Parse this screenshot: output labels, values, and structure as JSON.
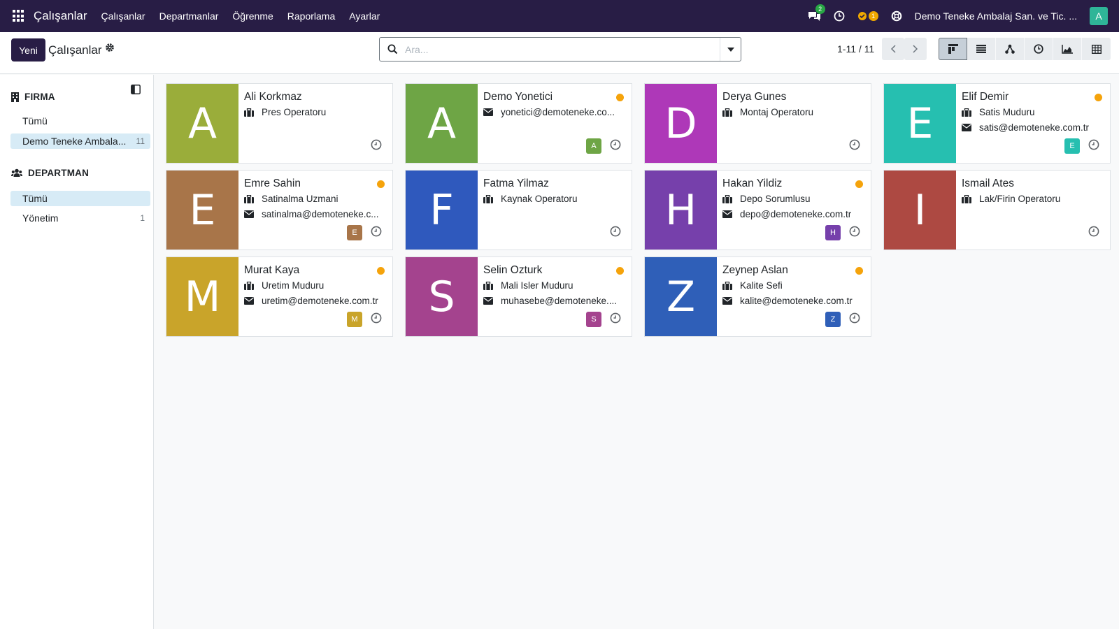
{
  "navbar": {
    "app_name": "Çalışanlar",
    "menu": [
      "Çalışanlar",
      "Departmanlar",
      "Öğrenme",
      "Raporlama",
      "Ayarlar"
    ],
    "messages_count": "2",
    "activities_count": "1",
    "company": "Demo Teneke Ambalaj San. ve Tic. ...",
    "user_initial": "A"
  },
  "control": {
    "new_label": "Yeni",
    "title": "Çalışanlar",
    "search_placeholder": "Ara...",
    "pager": "1-11 / 11"
  },
  "sidebar": {
    "firma_header": "FIRMA",
    "firma_items": [
      {
        "label": "Tümü",
        "count": ""
      },
      {
        "label": "Demo Teneke Ambala...",
        "count": "11"
      }
    ],
    "dept_header": "DEPARTMAN",
    "dept_items": [
      {
        "label": "Tümü",
        "count": ""
      },
      {
        "label": "Yönetim",
        "count": "1"
      }
    ]
  },
  "employees": [
    {
      "initial": "A",
      "color": "#9aad3a",
      "name": "Ali Korkmaz",
      "job": "Pres Operatoru",
      "email": "",
      "online": false,
      "mini": ""
    },
    {
      "initial": "A",
      "color": "#6ea545",
      "name": "Demo Yonetici",
      "job": "",
      "email": "yonetici@demoteneke.co...",
      "online": true,
      "mini": "A"
    },
    {
      "initial": "D",
      "color": "#ae38b8",
      "name": "Derya Gunes",
      "job": "Montaj Operatoru",
      "email": "",
      "online": false,
      "mini": ""
    },
    {
      "initial": "E",
      "color": "#26bfb0",
      "name": "Elif Demir",
      "job": "Satis Muduru",
      "email": "satis@demoteneke.com.tr",
      "online": true,
      "mini": "E"
    },
    {
      "initial": "E",
      "color": "#a87549",
      "name": "Emre Sahin",
      "job": "Satinalma Uzmani",
      "email": "satinalma@demoteneke.c...",
      "online": true,
      "mini": "E"
    },
    {
      "initial": "F",
      "color": "#2f59bd",
      "name": "Fatma Yilmaz",
      "job": "Kaynak Operatoru",
      "email": "",
      "online": false,
      "mini": ""
    },
    {
      "initial": "H",
      "color": "#7640ab",
      "name": "Hakan Yildiz",
      "job": "Depo Sorumlusu",
      "email": "depo@demoteneke.com.tr",
      "online": true,
      "mini": "H"
    },
    {
      "initial": "I",
      "color": "#ad4942",
      "name": "Ismail Ates",
      "job": "Lak/Firin Operatoru",
      "email": "",
      "online": false,
      "mini": ""
    },
    {
      "initial": "M",
      "color": "#c9a42a",
      "name": "Murat Kaya",
      "job": "Uretim Muduru",
      "email": "uretim@demoteneke.com.tr",
      "online": true,
      "mini": "M"
    },
    {
      "initial": "S",
      "color": "#a4438e",
      "name": "Selin Ozturk",
      "job": "Mali Isler Muduru",
      "email": "muhasebe@demoteneke....",
      "online": true,
      "mini": "S"
    },
    {
      "initial": "Z",
      "color": "#2f5fb8",
      "name": "Zeynep Aslan",
      "job": "Kalite Sefi",
      "email": "kalite@demoteneke.com.tr",
      "online": true,
      "mini": "Z"
    }
  ]
}
